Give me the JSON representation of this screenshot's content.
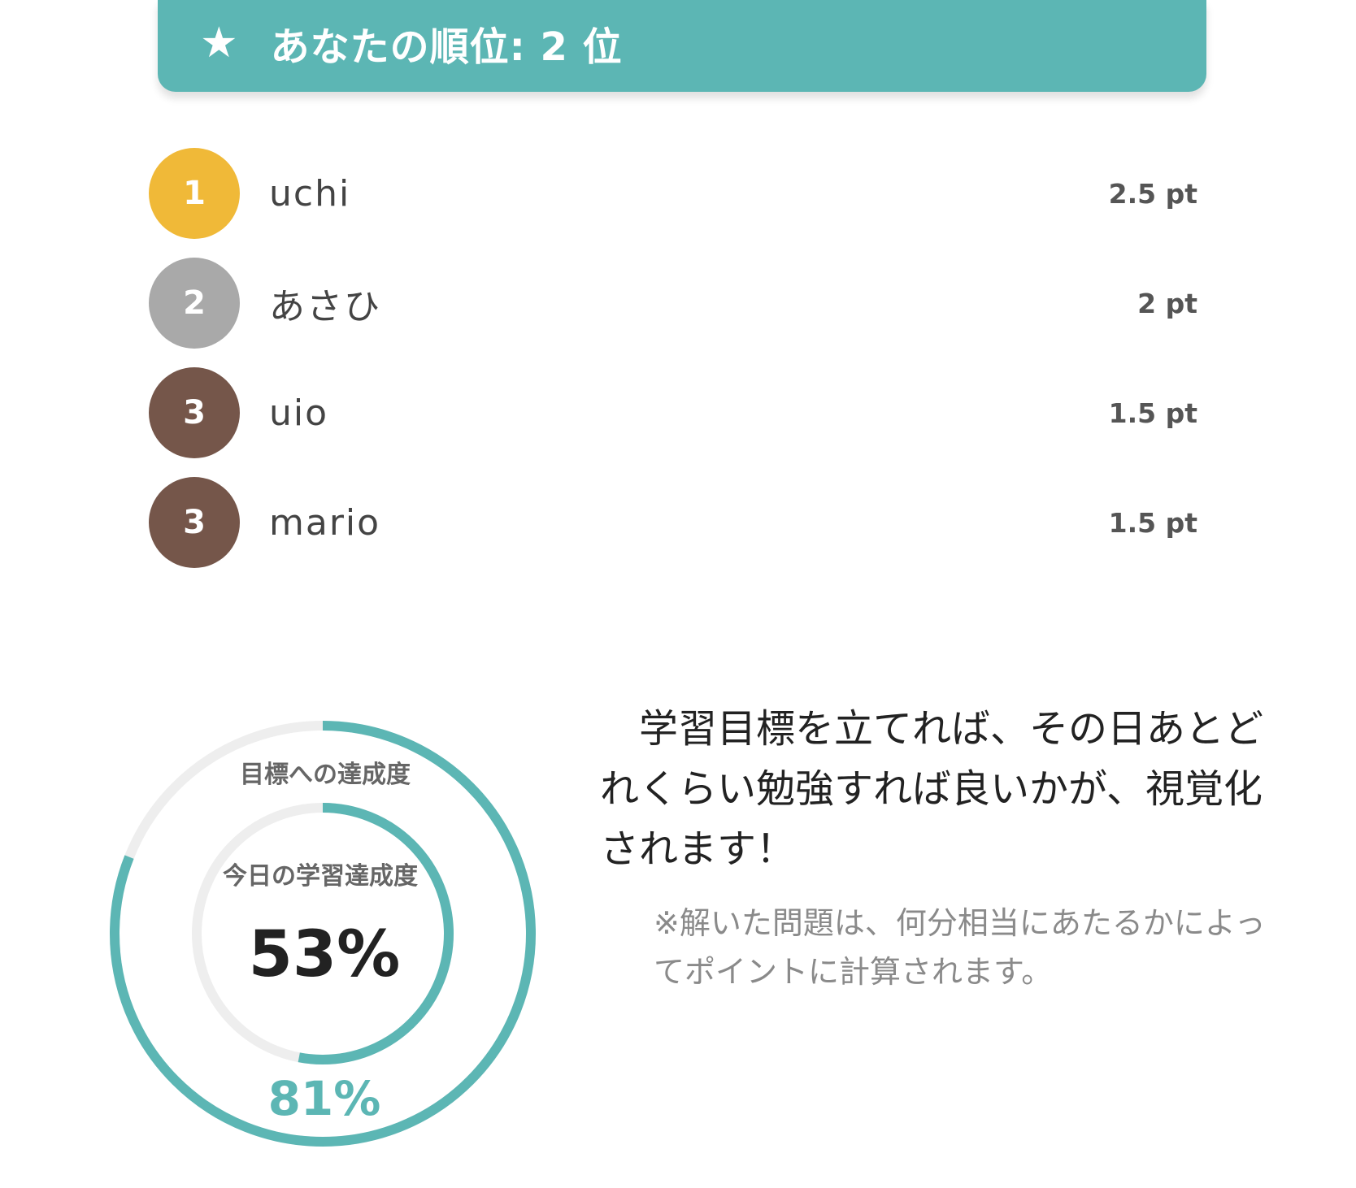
{
  "banner": {
    "star_icon": "star-icon",
    "text": "あなたの順位: 2 位",
    "color": "#5cb6b4"
  },
  "ranking": [
    {
      "rank": "1",
      "name": "uchi",
      "points": "2.5 pt",
      "badge_color": "#f0b938"
    },
    {
      "rank": "2",
      "name": "あさひ",
      "points": "2 pt",
      "badge_color": "#a9a9a9"
    },
    {
      "rank": "3",
      "name": "uio",
      "points": "1.5 pt",
      "badge_color": "#75564a"
    },
    {
      "rank": "3",
      "name": "mario",
      "points": "1.5 pt",
      "badge_color": "#75564a"
    }
  ],
  "gauge": {
    "outer_label": "目標への達成度",
    "outer_value": "81%",
    "outer_fraction": 0.81,
    "inner_label": "今日の学習達成度",
    "inner_value": "53%",
    "inner_fraction": 0.53,
    "accent_color": "#5cb6b4",
    "track_color": "#eeeeee"
  },
  "description": "　学習目標を立てれば、その日あとどれくらい勉強すれば良いかが、視覚化されます！",
  "note": "※解いた問題は、何分相当にあたるかによってポイントに計算されます。"
}
